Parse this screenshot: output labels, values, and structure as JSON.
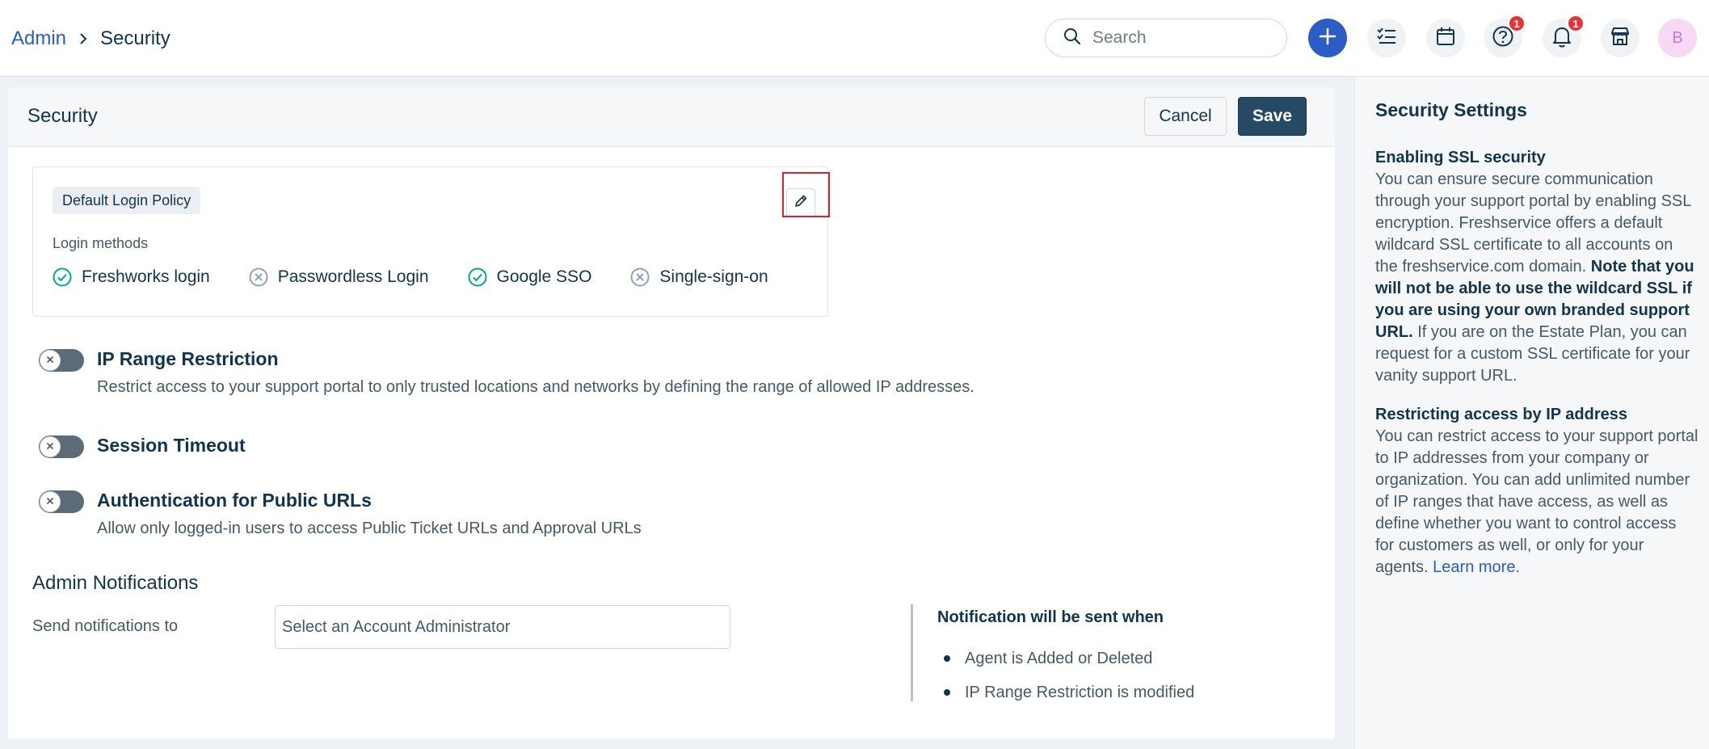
{
  "breadcrumb": {
    "parent": "Admin",
    "current": "Security"
  },
  "topbar": {
    "search_placeholder": "Search",
    "help_badge": "1",
    "notifications_badge": "1",
    "avatar_initial": "B"
  },
  "page": {
    "title": "Security",
    "cancel_label": "Cancel",
    "save_label": "Save"
  },
  "login_policy": {
    "tag": "Default Login Policy",
    "methods_label": "Login methods",
    "methods": [
      {
        "label": "Freshworks login",
        "enabled": true
      },
      {
        "label": "Passwordless Login",
        "enabled": false
      },
      {
        "label": "Google SSO",
        "enabled": true
      },
      {
        "label": "Single-sign-on",
        "enabled": false
      }
    ]
  },
  "settings": {
    "ip_range": {
      "title": "IP Range Restriction",
      "description": "Restrict access to your support portal to only trusted locations and networks by defining the range of allowed IP addresses.",
      "enabled": false
    },
    "session_timeout": {
      "title": "Session Timeout",
      "enabled": false
    },
    "public_urls": {
      "title": "Authentication for Public URLs",
      "description": "Allow only logged-in users to access Public Ticket URLs and Approval URLs",
      "enabled": false
    }
  },
  "admin_notifications": {
    "title": "Admin Notifications",
    "send_label": "Send notifications to",
    "select_placeholder": "Select an Account Administrator",
    "when_title": "Notification will be sent when",
    "items": [
      "Agent is Added or Deleted",
      "IP Range Restriction is modified"
    ]
  },
  "help": {
    "title": "Security Settings",
    "ssl_heading": "Enabling SSL security",
    "ssl_text_1": "You can ensure secure communication through your support portal by enabling SSL encryption. Freshservice offers a default wildcard SSL certificate to all accounts on the freshservice.com domain.",
    "ssl_bold": "Note that you will not be able to use the wildcard SSL if you are using your own branded support URL.",
    "ssl_text_2": "If you are on the Estate Plan, you can request for a custom SSL certificate for your vanity support URL.",
    "ip_heading": "Restricting access by IP address",
    "ip_text": "You can restrict access to your support portal to IP addresses from your company or organization. You can add unlimited number of IP ranges that have access, as well as define whether you want to control access for customers as well, or only for your agents.",
    "learn_more": "Learn more."
  },
  "colors": {
    "brand_blue": "#2c5cc5",
    "save_button": "#264966",
    "enabled_check": "#00a886",
    "disabled_x": "#92a2b1",
    "highlight_red": "#e0202a",
    "badge_red": "#e43538"
  }
}
